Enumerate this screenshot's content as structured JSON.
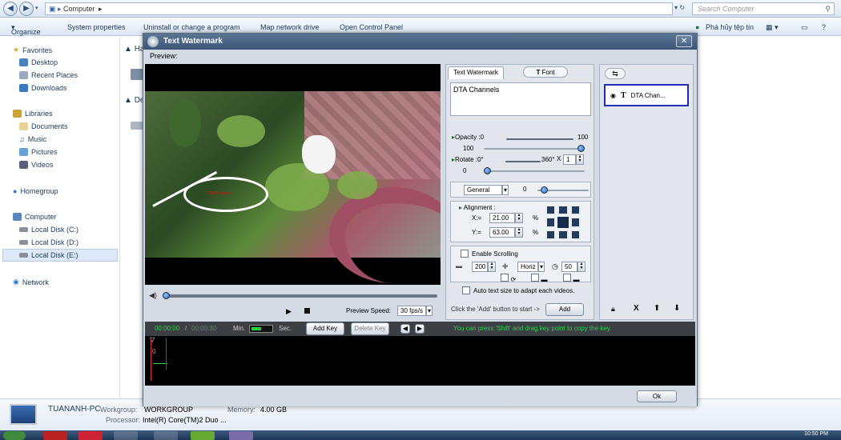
{
  "explorer": {
    "address": "Computer",
    "search_placeholder": "Search Computer",
    "toolbar": [
      "Organize",
      "System properties",
      "Uninstall or change a program",
      "Map network drive",
      "Open Control Panel"
    ],
    "toolbar_right": "Phá hủy tệp tin",
    "sidebar": {
      "favorites": "Favorites",
      "favorites_items": [
        "Desktop",
        "Recent Places",
        "Downloads"
      ],
      "libraries": "Libraries",
      "libraries_items": [
        "Documents",
        "Music",
        "Pictures",
        "Videos"
      ],
      "homegroup": "Homegroup",
      "computer": "Computer",
      "disks": [
        "Local Disk (C:)",
        "Local Disk (D:)",
        "Local Disk (E:)"
      ],
      "network": "Network"
    },
    "main_headers": [
      "Ha",
      "De"
    ],
    "status": {
      "pc_name": "TUANANH-PC",
      "workgroup_label": "Workgroup:",
      "workgroup": "WORKGROUP",
      "memory_label": "Memory:",
      "memory": "4.00 GB",
      "processor_label": "Processor:",
      "processor": "Intel(R) Core(TM)2 Duo ..."
    },
    "clock": "10:50 PM"
  },
  "dialog": {
    "title": "Text Watermark",
    "preview_label": "Preview:",
    "preview_speed_label": "Preview Speed:",
    "preview_speed": "30 fps/s",
    "tab_text_watermark": "Text Watermark",
    "tab_font": "Font",
    "watermark_text": "DTA Channels",
    "opacity_label": "Opacity :",
    "opacity_min": "0",
    "opacity_max": "100",
    "opacity_value": "100",
    "rotate_label": "Rotate :",
    "rotate_min": "0°",
    "rotate_max": "360°",
    "rotate_x": "X",
    "rotate_multiplier": "1",
    "rotate_value": "0",
    "general_select": "General",
    "general_value": "0",
    "alignment_label": "Alignment :",
    "x_label": "X:=",
    "x_value": "21.00",
    "y_label": "Y:=",
    "y_value": "63.00",
    "percent": "%",
    "enable_scrolling": "Enable Scrolling",
    "scroll_speed": "200",
    "scroll_direction": "Horiz",
    "scroll_time": "50",
    "auto_text_size": "Auto text size to adapt each videos.",
    "add_hint": "Click the 'Add' button to start ->",
    "add_button": "Add",
    "layer_name": "DTA Chan...",
    "timeline": {
      "time_current": "00:00:00",
      "time_separator": "/",
      "time_total": "00:00:30",
      "min_label": "Min.",
      "sec_label": "Sec.",
      "add_key": "Add Key",
      "delete_key": "Delete Key",
      "hint": "You can press 'Shift' and drag key point to copy the key.",
      "ruler_zero": "0"
    },
    "ok": "Ok",
    "opacity_level": 1.0,
    "rotate_level": 0.0
  },
  "video": {
    "watermark_preview": "DTA Channels"
  },
  "colors": {
    "accent": "#1d2eb3",
    "timeline_hint": "#2bd14a",
    "title_bar": "#4a6282"
  }
}
